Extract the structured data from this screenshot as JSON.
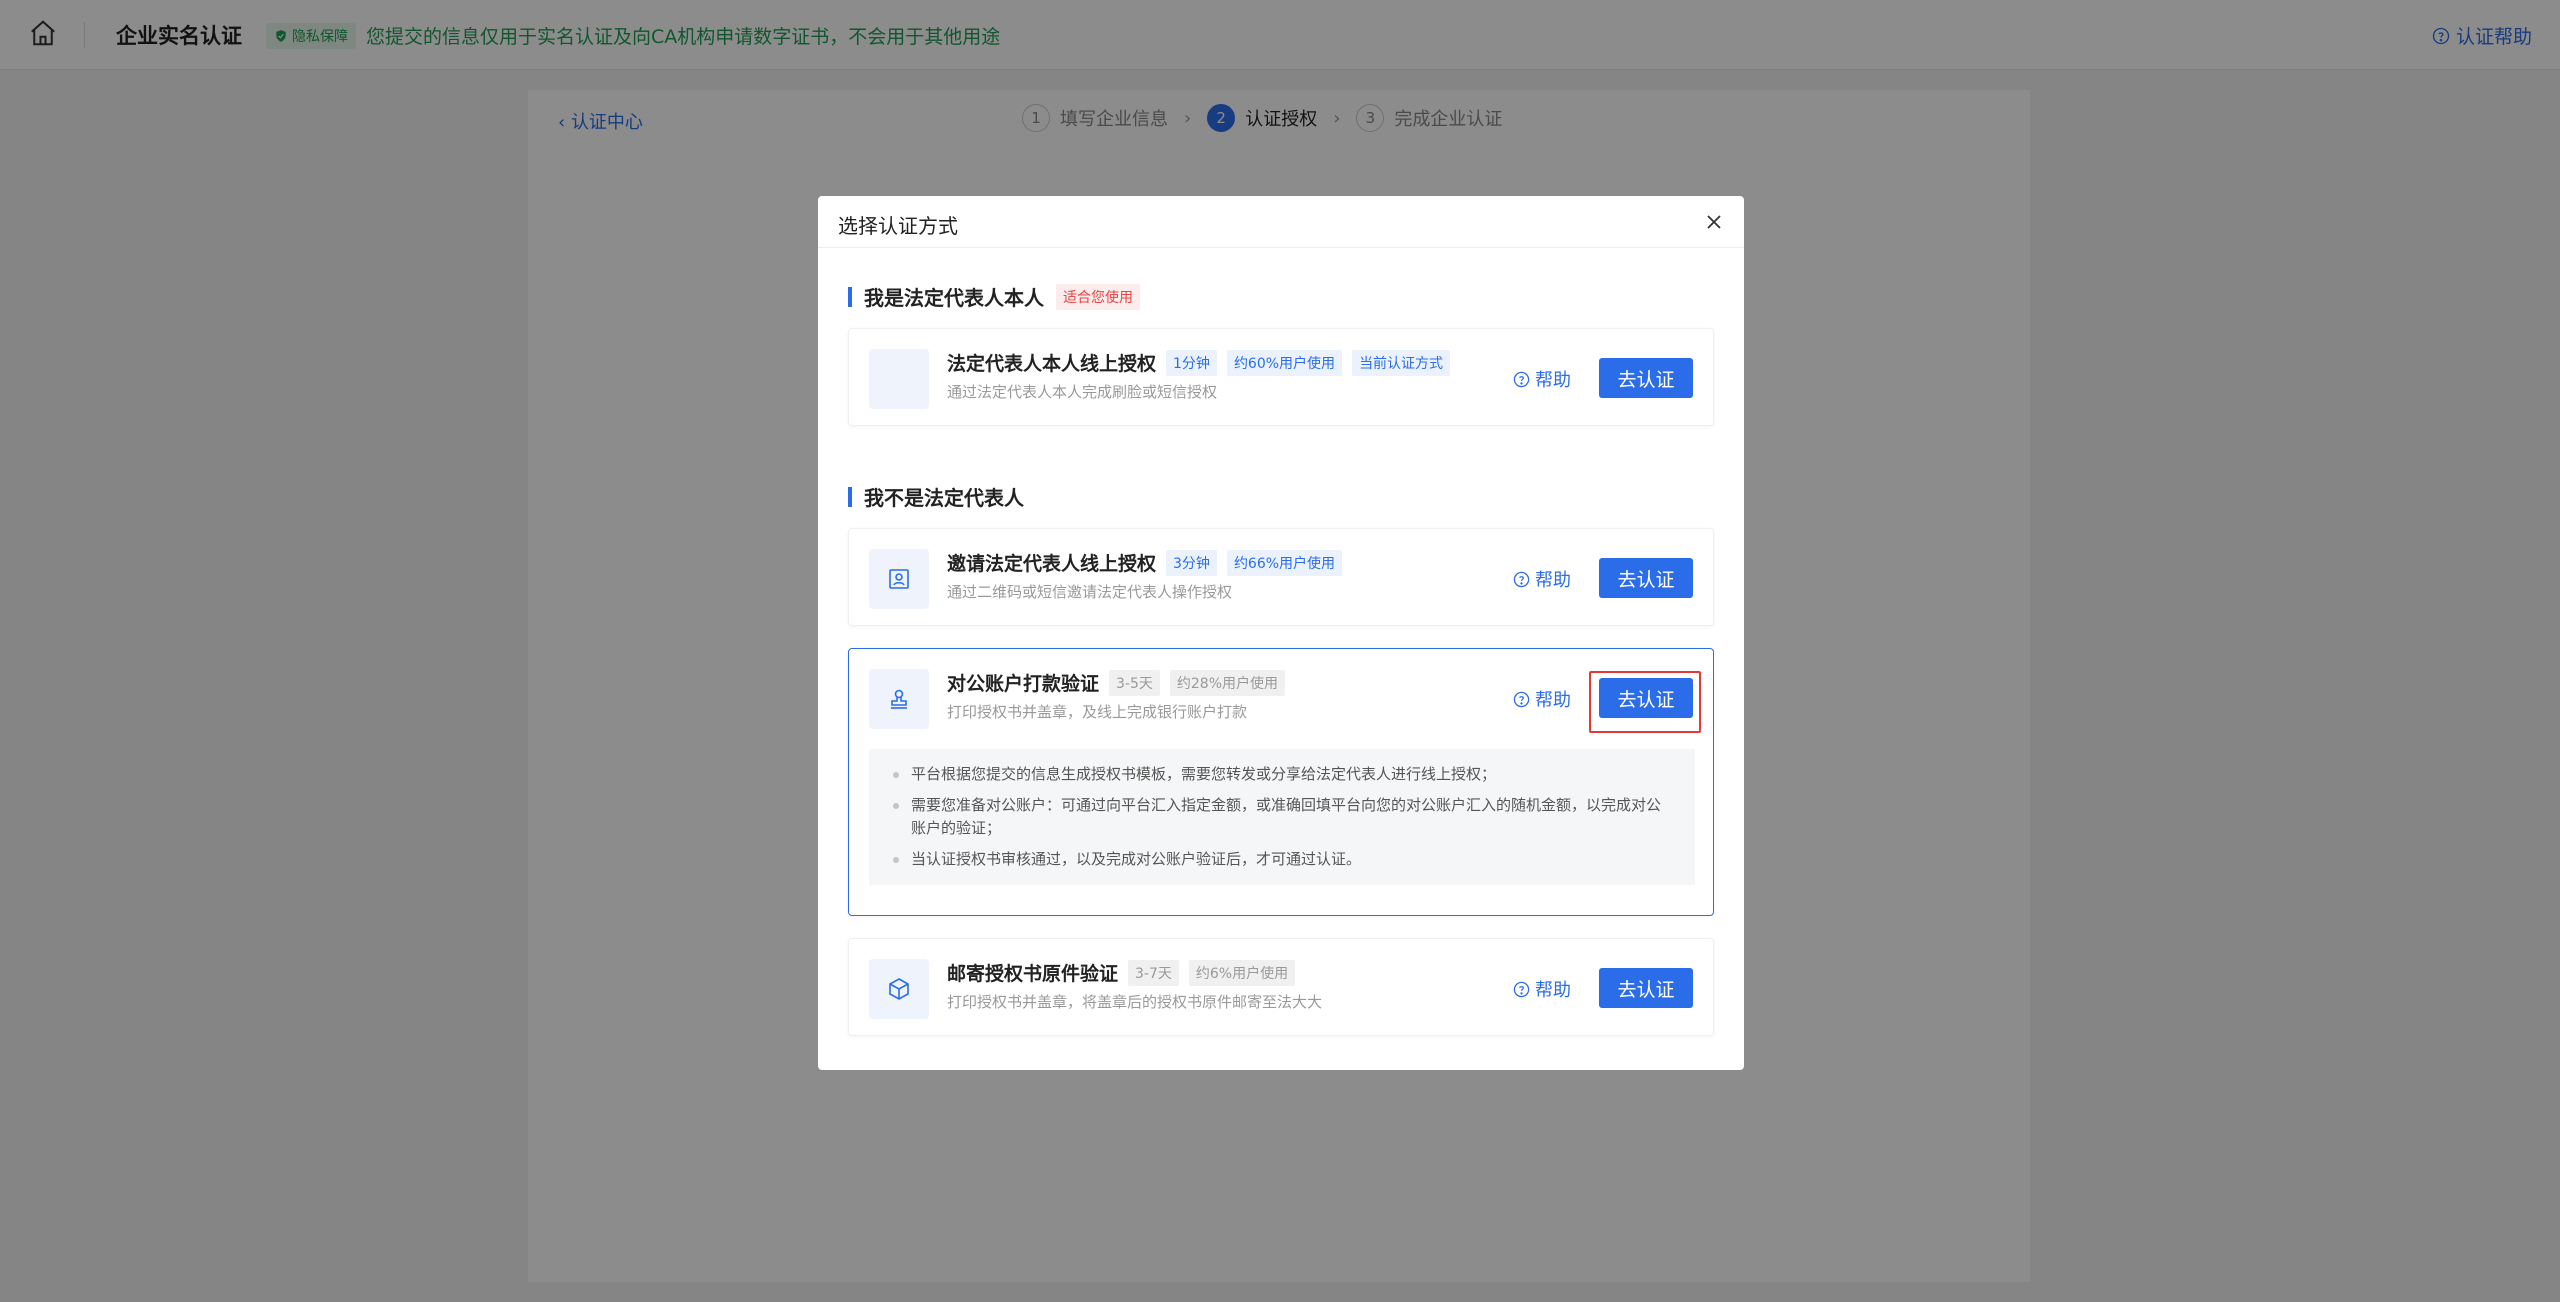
{
  "header": {
    "brand": "企业实名认证",
    "privacy_badge": "隐私保障",
    "privacy_text": "您提交的信息仅用于实名认证及向CA机构申请数字证书，不会用于其他用途",
    "help": "认证帮助"
  },
  "content": {
    "back_link": "认证中心",
    "steps": [
      {
        "num": "1",
        "label": "填写企业信息",
        "active": false
      },
      {
        "num": "2",
        "label": "认证授权",
        "active": true
      },
      {
        "num": "3",
        "label": "完成企业认证",
        "active": false
      }
    ]
  },
  "modal": {
    "title": "选择认证方式",
    "section1": {
      "title": "我是法定代表人本人",
      "tag": "适合您使用"
    },
    "section2": {
      "title": "我不是法定代表人"
    },
    "cards": [
      {
        "title": "法定代表人本人线上授权",
        "tags": [
          "1分钟",
          "约60%用户使用",
          "当前认证方式"
        ],
        "desc": "通过法定代表人本人完成刷脸或短信授权",
        "help": "帮助",
        "button": "去认证"
      },
      {
        "title": "邀请法定代表人线上授权",
        "tags": [
          "3分钟",
          "约66%用户使用"
        ],
        "desc": "通过二维码或短信邀请法定代表人操作授权",
        "help": "帮助",
        "button": "去认证"
      },
      {
        "title": "对公账户打款验证",
        "tags": [
          "3-5天",
          "约28%用户使用"
        ],
        "desc": "打印授权书并盖章，及线上完成银行账户打款",
        "help": "帮助",
        "button": "去认证",
        "notes": [
          "平台根据您提交的信息生成授权书模板，需要您转发或分享给法定代表人进行线上授权；",
          "需要您准备对公账户：可通过向平台汇入指定金额，或准确回填平台向您的对公账户汇入的随机金额，以完成对公账户的验证；",
          "当认证授权书审核通过，以及完成对公账户验证后，才可通过认证。"
        ]
      },
      {
        "title": "邮寄授权书原件验证",
        "tags": [
          "3-7天",
          "约6%用户使用"
        ],
        "desc": "打印授权书并盖章，将盖章后的授权书原件邮寄至法大大",
        "help": "帮助",
        "button": "去认证"
      }
    ]
  }
}
